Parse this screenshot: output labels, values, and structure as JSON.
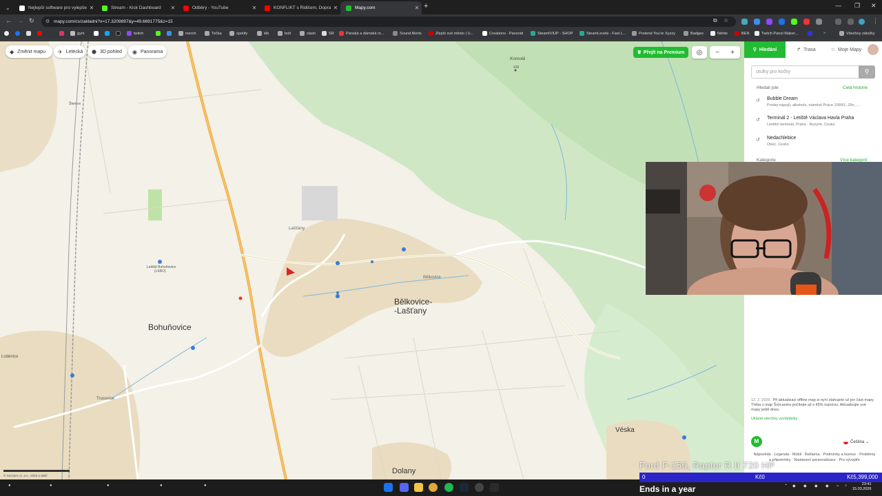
{
  "browser": {
    "tabs": [
      {
        "title": "Nejlepší software pro vylepšen",
        "color": "#ffffff",
        "active": false
      },
      {
        "title": "Stream - Kick Dashboard",
        "color": "#53fc18",
        "active": false
      },
      {
        "title": "Odběry - YouTube",
        "color": "#ff0000",
        "active": false
      },
      {
        "title": "KONFLIKT s Řidičem, Dopravní",
        "color": "#ff0000",
        "active": false
      },
      {
        "title": "Mapy.com",
        "color": "#22bb33",
        "active": true
      }
    ],
    "url": "mapy.com/cs/zakladni?x=17.3209897&y=49.6691775&z=15",
    "bookmarks": [
      "gym",
      "twitch",
      "merch",
      "Tečka",
      "spotify",
      "idk",
      "bolt",
      "clash",
      "SR",
      "Pánská a dámská m...",
      "Sound Alerts",
      "Zlepši své město | U...",
      "Creations - Panzoid",
      "SteamIVIUP - SHOP",
      "SteamLevels - Fast L...",
      "Pretend You're Xyzzy",
      "Badges",
      "Nérite",
      "BEN",
      "Twitch Panel Maker...",
      "Všechny záložky"
    ]
  },
  "map": {
    "tools": [
      "Změnit mapu",
      "Letecká",
      "3D pohled",
      "Panorama"
    ],
    "premium_label": "Přejít na Premium",
    "zoom_out": "−",
    "zoom_in": "+",
    "places": {
      "bohunovice": "Bohuňovice",
      "belkovice": "Bělkovice-",
      "belkovice2": "-Lašťany",
      "belkovice_small": "Bělkovice",
      "lastany": "Lašťany",
      "veska": "Véska",
      "dolany": "Dolany",
      "komola": "Komolá",
      "komola_height": "439",
      "letiste": "Letiště Bohuňovice",
      "letiste_code": "(LKBO)",
      "lodenice": "Lodenice",
      "trusovice": "Trusovice",
      "sternov": "Šternov"
    },
    "scale_text": "© Seznam.cz, a.s., 2026 a další"
  },
  "panel": {
    "tabs": [
      "Hledání",
      "Trasa",
      "Moje Mapy"
    ],
    "search_placeholder": "útulky pro kočky",
    "history_title": "Hledali jste",
    "history_all": "Celá historie",
    "history": [
      {
        "title": "Bubble Dream",
        "sub": "Prodej nápojů, alkoholu, náměstí Práce 1099/1, Zlín, ..."
      },
      {
        "title": "Terminál 2 - Letiště Václava Havla Praha",
        "sub": "Letištní terminál, Praha - Ruzyně, Česko"
      },
      {
        "title": "Nedachlebice",
        "sub": "Obec, Česko"
      }
    ],
    "categories": "Kategorie",
    "more_categories": "Více kategorií",
    "notice_date": "12. 2. 2026",
    "notice": "Při aktualizaci offline map si nyní stahujete už jen část mapy. Třeba u map Švýcarska počítejte až s 45% úsporou. Aktualizujte své mapy ještě dnes.",
    "notice_link": "Ukázat všechny vychytávky",
    "logo": "M",
    "language": "Čeština",
    "footer": "Nápověda · Legenda · Mobil · Reklama · Podmínky a licence · Problémy a připomínky · Nastavení personalizace · Pro vývojáře"
  },
  "stream": {
    "overlay": "Ford F-150, Raptor R II 720 HP",
    "bar_left": "0",
    "bar_mid": "Kč0",
    "bar_right": "Kč5,399,000",
    "ends": "Ends in a year"
  },
  "system": {
    "time": "23:41",
    "date": "15.03.2026"
  }
}
